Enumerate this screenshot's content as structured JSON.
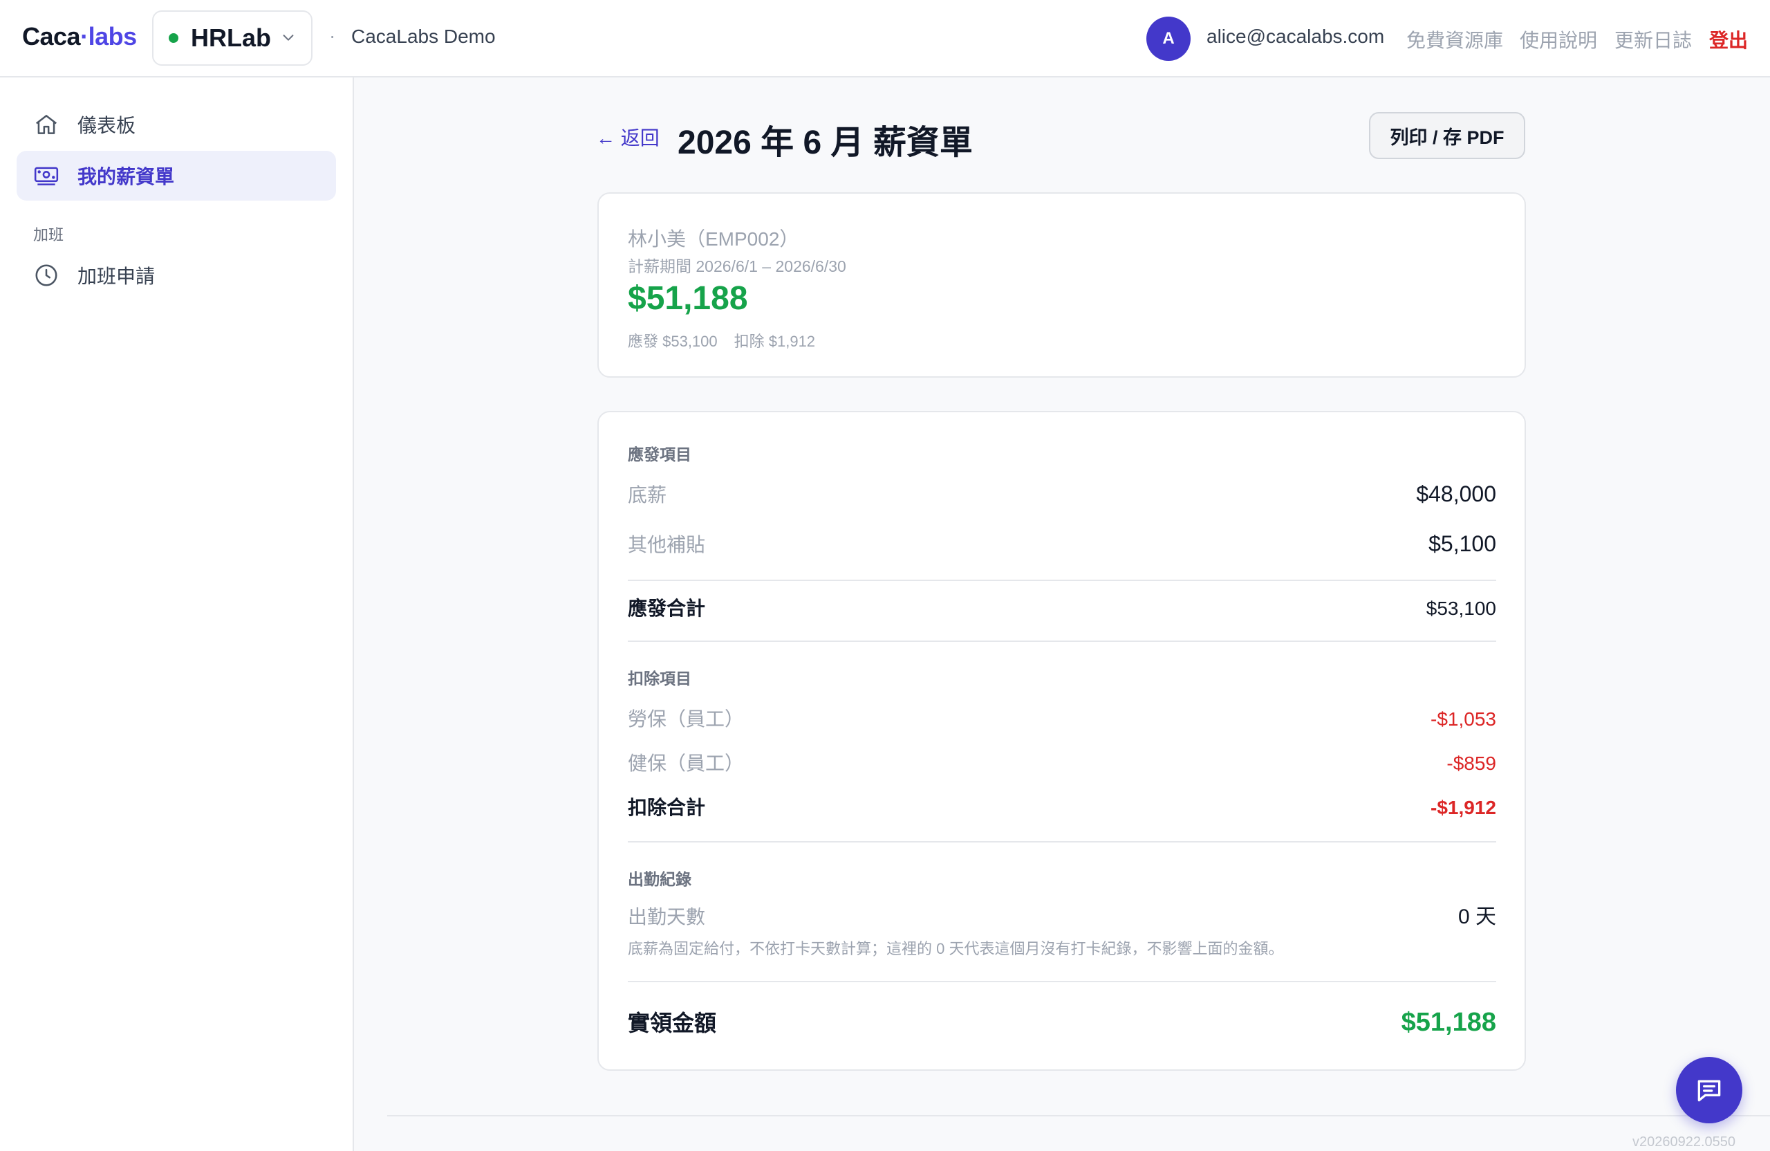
{
  "brand": {
    "logo_left": "Caca",
    "logo_dot": "·",
    "logo_right": "labs"
  },
  "workspace": {
    "name": "HRLab",
    "status_color": "#16a34a"
  },
  "breadcrumb": {
    "separator": "·",
    "current": "CacaLabs Demo"
  },
  "user": {
    "avatar_initial": "A",
    "email": "alice@cacalabs.com"
  },
  "top_nav": {
    "resources": "免費資源庫",
    "guide": "使用說明",
    "changelog": "更新日誌",
    "logout": "登出"
  },
  "sidebar": {
    "items": [
      {
        "label": "儀表板",
        "icon": "home-icon",
        "active": false
      },
      {
        "label": "我的薪資單",
        "icon": "payslip-icon",
        "active": true
      }
    ],
    "section_label": "加班",
    "section_items": [
      {
        "label": "加班申請",
        "icon": "clock-icon",
        "active": false
      }
    ]
  },
  "page": {
    "back_label": "← 返回",
    "title": "2026 年 6 月 薪資單",
    "print_label": "列印 / 存 PDF"
  },
  "summary": {
    "employee": "林小美（EMP002）",
    "period": "計薪期間 2026/6/1 – 2026/6/30",
    "net_pay": "$51,188",
    "gross_label": "應發 $53,100",
    "deduction_label": "扣除 $1,912"
  },
  "earnings": {
    "section_label": "應發項目",
    "items": [
      {
        "label": "底薪",
        "amount": "$48,000"
      },
      {
        "label": "其他補貼",
        "amount": "$5,100"
      }
    ],
    "total_label": "應發合計",
    "total_amount": "$53,100"
  },
  "deductions": {
    "section_label": "扣除項目",
    "items": [
      {
        "label": "勞保（員工）",
        "amount": "-$1,053"
      },
      {
        "label": "健保（員工）",
        "amount": "-$859"
      }
    ],
    "total_label": "扣除合計",
    "total_amount": "-$1,912"
  },
  "attendance": {
    "section_label": "出勤紀錄",
    "days_label": "出勤天數",
    "days_value": "0 天",
    "note": "底薪為固定給付，不依打卡天數計算；這裡的 0 天代表這個月沒有打卡紀錄，不影響上面的金額。"
  },
  "net": {
    "label": "實領金額",
    "amount": "$51,188"
  },
  "footer": {
    "version": "v20260922.0550"
  },
  "colors": {
    "accent": "#4338ca",
    "positive": "#16a34a",
    "negative": "#dc2626"
  }
}
